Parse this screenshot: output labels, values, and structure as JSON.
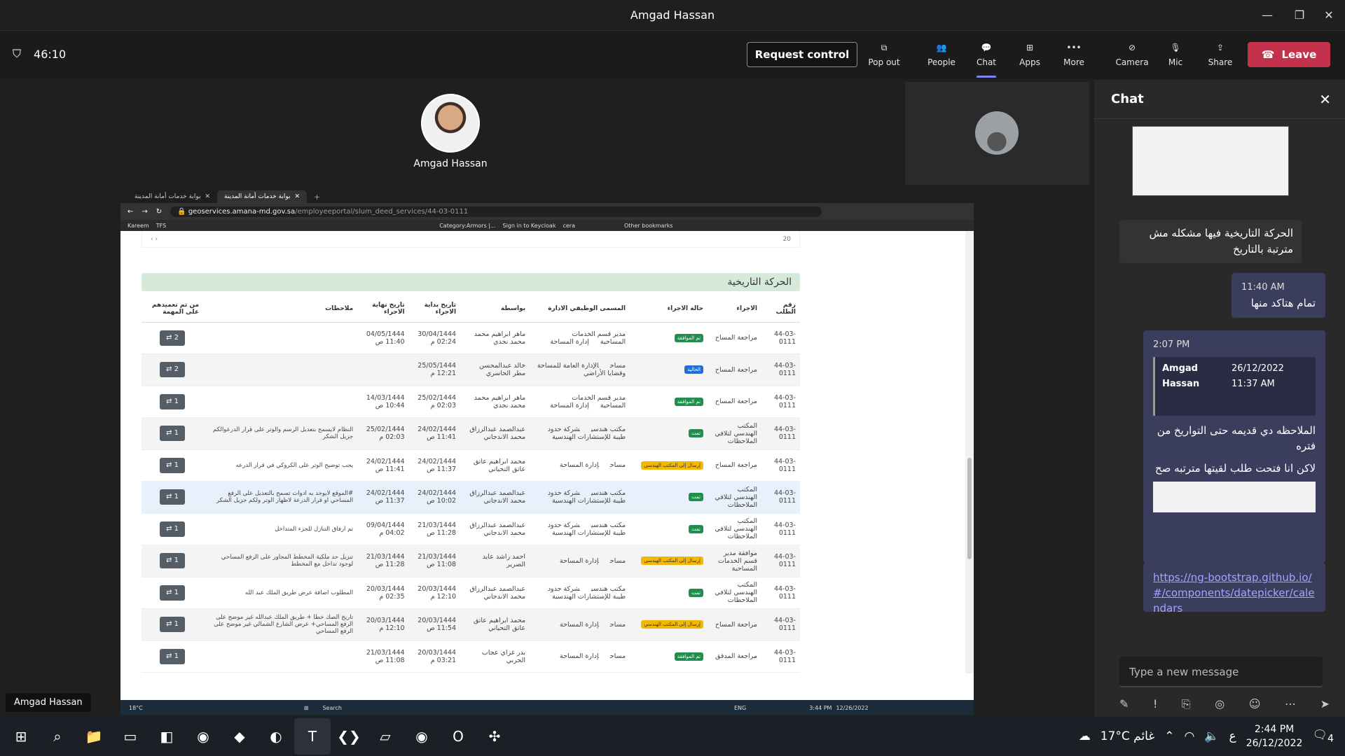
{
  "window": {
    "title": "Amgad Hassan"
  },
  "meeting": {
    "timer": "46:10",
    "request_control": "Request control",
    "buttons": [
      {
        "label": "Pop out",
        "icon": "pop-out-icon"
      },
      {
        "label": "People",
        "icon": "people-icon"
      },
      {
        "label": "Chat",
        "icon": "chat-icon"
      },
      {
        "label": "Apps",
        "icon": "apps-icon"
      },
      {
        "label": "More",
        "icon": "more-icon"
      },
      {
        "label": "Camera",
        "icon": "camera-off-icon"
      },
      {
        "label": "Mic",
        "icon": "mic-icon"
      },
      {
        "label": "Share",
        "icon": "share-icon"
      }
    ],
    "leave": "Leave",
    "participant": "Amgad Hassan",
    "presenter_label": "Amgad Hassan"
  },
  "browser": {
    "tabs": [
      "بوابة خدمات أمانة المدينة",
      "بوابة خدمات أمانة المدينة"
    ],
    "url_host": "geoservices.amana-md.gov.sa",
    "url_path": "/employeeportal/slum_deed_services/44-03-0111",
    "bookmarks": [
      "Kareem",
      "TFS",
      "Category:Armors |...",
      "Sign in to Keycloak",
      "cera",
      "Other bookmarks"
    ]
  },
  "page": {
    "pager_size": "20",
    "section_title": "الحركة التاريخية",
    "columns": [
      "رقم الطلب",
      "الاجراء",
      "حالة الاجراء",
      "المسمى الوظيفي الادارة",
      "بواسطة",
      "تاريخ بداية الاجراء",
      "تاريخ نهاية الاجراء",
      "ملاحظات",
      "من تم تعميدهم على المهمة"
    ],
    "rows": [
      {
        "num": "44-03-0111",
        "action": "مراجعة المساح",
        "status": "تم الموافقة",
        "status_type": "green",
        "job": "مدير قسم الخدمات المساحية",
        "dept": "إدارة المساحة",
        "by": "ماهر ابراهيم محمد محمد نجدي",
        "start": "30/04/1444 02:24 م",
        "end": "04/05/1444 11:40 ص",
        "notes": "",
        "count": "2"
      },
      {
        "num": "44-03-0111",
        "action": "مراجعة المساح",
        "status": "الحالية",
        "status_type": "blue",
        "job": "مساح",
        "dept": "الإدارة العامة للمساحة وقضايا الأراضي",
        "by": "خالد عبدالمحسن مطر الحاسري",
        "start": "25/05/1444 12:21 م",
        "end": "",
        "notes": "",
        "count": "2"
      },
      {
        "num": "44-03-0111",
        "action": "مراجعة المساح",
        "status": "تم الموافقة",
        "status_type": "green",
        "job": "مدير قسم الخدمات المساحية",
        "dept": "إدارة المساحة",
        "by": "ماهر ابراهيم محمد محمد نجدي",
        "start": "25/02/1444 02:03 م",
        "end": "14/03/1444 10:44 ص",
        "notes": "",
        "count": "1"
      },
      {
        "num": "44-03-0111",
        "action": "المكتب الهندسي لتلافي الملاحظات",
        "status": "تمت",
        "status_type": "green",
        "job": "مكتب هندسي",
        "dept": "شركة حدود طيبة للإستشارات الهندسية",
        "by": "عبدالصمد عبدالرزاق محمد الاندجاني",
        "start": "24/02/1444 11:41 ص",
        "end": "25/02/1444 02:03 م",
        "notes": "النظام لايسمح بتعديل الرسم والوتر على قرار الدرعوالكم جزيل الشكر",
        "count": "1"
      },
      {
        "num": "44-03-0111",
        "action": "مراجعة المساح",
        "status": "إرسال إلى المكتب الهندسي",
        "status_type": "yellow",
        "job": "مساح",
        "dept": "إدارة المساحة",
        "by": "محمد ابراهيم عاتق عاتق التحياني",
        "start": "24/02/1444 11:37 ص",
        "end": "24/02/1444 11:41 ص",
        "notes": "يجب توضيح الوتر على الكروكي في قرار الدرعه",
        "count": "1"
      },
      {
        "num": "44-03-0111",
        "action": "المكتب الهندسي لتلافي الملاحظات",
        "status": "تمت",
        "status_type": "green",
        "job": "مكتب هندسي",
        "dept": "شركة حدود طيبة للإستشارات الهندسية",
        "by": "عبدالصمد عبدالرزاق محمد الاندجاني",
        "start": "24/02/1444 10:02 ص",
        "end": "24/02/1444 11:37 ص",
        "notes": "#الموقع لايوجد به ادوات تسمح بالتعديل على الرفع المساحي او قرار الدرعة لاظهار الوتر ولكم جزيل الشكر",
        "count": "1"
      },
      {
        "num": "44-03-0111",
        "action": "المكتب الهندسي لتلافي الملاحظات",
        "status": "تمت",
        "status_type": "green",
        "job": "مكتب هندسي",
        "dept": "شركة حدود طيبة للإستشارات الهندسية",
        "by": "عبدالصمد عبدالرزاق محمد الاندجاني",
        "start": "21/03/1444 11:28 ص",
        "end": "09/04/1444 04:02 م",
        "notes": "تم ارفاق التنازل للجزء المتداخل",
        "count": "1"
      },
      {
        "num": "44-03-0111",
        "action": "موافقة مدير قسم الخدمات المساحية",
        "status": "إرسال إلى المكتب الهندسي",
        "status_type": "yellow",
        "job": "مساح",
        "dept": "إدارة المساحة",
        "by": "احمد راشد عايد الصرير",
        "start": "21/03/1444 11:08 ص",
        "end": "21/03/1444 11:28 ص",
        "notes": "تنزيل حد ملكية المخطط المجاور على الرفع المساحي لوجود تداخل مع المخطط",
        "count": "1"
      },
      {
        "num": "44-03-0111",
        "action": "المكتب الهندسي لتلافي الملاحظات",
        "status": "تمت",
        "status_type": "green",
        "job": "مكتب هندسي",
        "dept": "شركة حدود طيبة للإستشارات الهندسية",
        "by": "عبدالصمد عبدالرزاق محمد الاندجاني",
        "start": "20/03/1444 12:10 م",
        "end": "20/03/1444 02:35 م",
        "notes": "المطلوب اضافة عرض طريق الملك عبد الله",
        "count": "1"
      },
      {
        "num": "44-03-0111",
        "action": "مراجعة المساح",
        "status": "إرسال إلى المكتب الهندسي",
        "status_type": "yellow",
        "job": "مساح",
        "dept": "إدارة المساحة",
        "by": "محمد ابراهيم عاتق عاتق التحياني",
        "start": "20/03/1444 11:54 ص",
        "end": "20/03/1444 12:10 م",
        "notes": "تاريخ الصك خطا + طريق الملك عبدالله غير موضح على الرفع المساحي+ عرض الشارع الشمالي غير موضح على الرفع المساحي",
        "count": "1"
      },
      {
        "num": "44-03-0111",
        "action": "مراجعة المدقق",
        "status": "تم الموافقة",
        "status_type": "green",
        "job": "مساح",
        "dept": "إدارة المساحة",
        "by": "بدر غزاي عجاب الحربي",
        "start": "20/03/1444 03:21 م",
        "end": "21/03/1444 11:08 ص",
        "notes": "",
        "count": "1"
      }
    ]
  },
  "inner_taskbar": {
    "weather": "18°C",
    "search": "Search",
    "lang": "ENG",
    "time": "3:44 PM",
    "date": "12/26/2022"
  },
  "chat": {
    "title": "Chat",
    "messages": [
      {
        "text": "الحركة التاريخية فيها مشكله مش مترتبة بالتاريخ"
      },
      {
        "time": "11:40 AM",
        "text": "تمام هتاكد منها"
      },
      {
        "time": "2:07 PM",
        "quote_author": "Amgad Hassan",
        "quote_time": "26/12/2022 11:37 AM",
        "text1": "الملاحظه دي قديمه حتى التواريخ من فتره",
        "text2": "لاكن انا فتحت طلب لقيتها مترتبه صح"
      },
      {
        "link": "https://ng-bootstrap.github.io/#/components/datepicker/calendars"
      }
    ],
    "input_placeholder": "Type a new message"
  },
  "taskbar": {
    "weather": "17°C غائم",
    "lang": "ع",
    "time": "2:44 PM",
    "date": "26/12/2022",
    "notif": "4"
  }
}
